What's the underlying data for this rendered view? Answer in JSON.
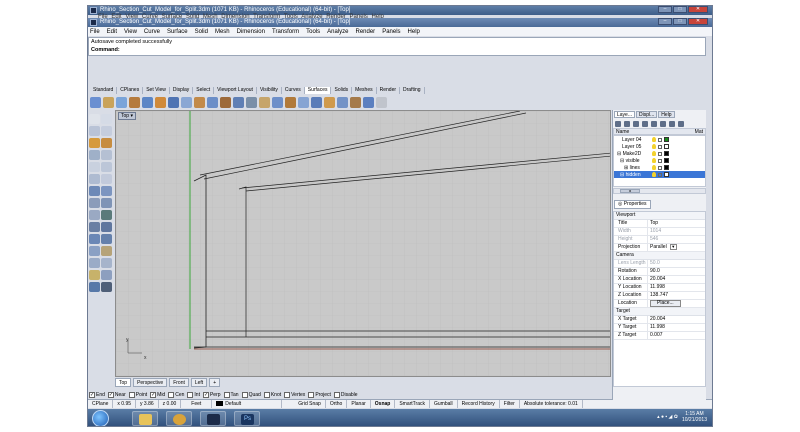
{
  "window": {
    "title_top": "Rhino_Section_Cut_Model_for_Split.3dm (1071 KB) - Rhinoceros (Educational) (64-bit) - [Top]",
    "title_second": "Rhino_Section_Cut_Model_for_Split.3dm (1071 KB) - Rhinoceros (Educational) (64-bit) - [Top]",
    "ghost_menu": "File  Edit  View  Curve  Surface  Solid  Mesh  Dimension  Transform  Tools  Analyze  Render  Panels  Help"
  },
  "menubar": [
    "File",
    "Edit",
    "View",
    "Curve",
    "Surface",
    "Solid",
    "Mesh",
    "Dimension",
    "Transform",
    "Tools",
    "Analyze",
    "Render",
    "Panels",
    "Help"
  ],
  "command": {
    "history": "Autosave completed successfully",
    "prompt": "Command:"
  },
  "toolbar_tabs": [
    "Standard",
    "CPlanes",
    "Set View",
    "Display",
    "Select",
    "Viewport Layout",
    "Visibility",
    "Curves",
    "Surfaces",
    "Solids",
    "Meshes",
    "Render",
    "Drafting"
  ],
  "toolbar_active_tab": "Surfaces",
  "viewport": {
    "name": "Top",
    "axis_x": "x",
    "axis_y": "y"
  },
  "view_tabs": [
    "Top",
    "Perspective",
    "Front",
    "Left"
  ],
  "view_tabs_add": "+",
  "osnaps": [
    {
      "label": "End",
      "checked": true
    },
    {
      "label": "Near",
      "checked": true
    },
    {
      "label": "Point",
      "checked": false
    },
    {
      "label": "Mid",
      "checked": true
    },
    {
      "label": "Cen",
      "checked": false
    },
    {
      "label": "Int",
      "checked": false
    },
    {
      "label": "Perp",
      "checked": true
    },
    {
      "label": "Tan",
      "checked": false
    },
    {
      "label": "Quad",
      "checked": false
    },
    {
      "label": "Knot",
      "checked": false
    },
    {
      "label": "Vertex",
      "checked": false
    },
    {
      "label": "Project",
      "checked": false
    },
    {
      "label": "Disable",
      "checked": false
    }
  ],
  "status": {
    "cplane": "CPlane",
    "x": "x 0.95",
    "y": "y 3.86",
    "z": "z 0.00",
    "units": "Feet",
    "layer": "Default",
    "grid_snap": "Grid Snap",
    "ortho": "Ortho",
    "planar": "Planar",
    "osnap": "Osnap",
    "smarttrack": "SmartTrack",
    "gumball": "Gumball",
    "record_history": "Record History",
    "filter": "Filter",
    "tolerance": "Absolute tolerance: 0.01"
  },
  "panel": {
    "tabs": [
      "Laye...",
      "Displ...",
      "Help"
    ],
    "layer_header_name": "Name",
    "layer_header_mat": "Mat",
    "layers": [
      {
        "name": "Layer 04",
        "color": "#1a8c1a",
        "selected": false
      },
      {
        "name": "Layer 05",
        "color": "#ffffff",
        "selected": false
      },
      {
        "name": "Make2D",
        "color": "#000000",
        "selected": false
      },
      {
        "name": "visible",
        "color": "#000000",
        "selected": false
      },
      {
        "name": "lines",
        "color": "#000000",
        "selected": false
      },
      {
        "name": "hidden",
        "color": "#ffffff",
        "selected": true
      }
    ],
    "scroll_thumb": "III",
    "properties_tab": "Properties",
    "properties": {
      "section_viewport": "Viewport",
      "title_k": "Title",
      "title_v": "Top",
      "width_k": "Width",
      "width_v": "1014",
      "height_k": "Height",
      "height_v": "546",
      "projection_k": "Projection",
      "projection_v": "Parallel",
      "section_camera": "Camera",
      "lens_k": "Lens Length",
      "lens_v": "50.0",
      "rotation_k": "Rotation",
      "rotation_v": "90.0",
      "xloc_k": "X Location",
      "xloc_v": "20.004",
      "yloc_k": "Y Location",
      "yloc_v": "11.998",
      "zloc_k": "Z Location",
      "zloc_v": "138.747",
      "location_k": "Location",
      "location_btn": "Place...",
      "section_target": "Target",
      "xt_k": "X Target",
      "xt_v": "20.004",
      "yt_k": "Y Target",
      "yt_v": "11.998",
      "zt_k": "Z Target",
      "zt_v": "0.007"
    }
  },
  "tray": {
    "time": "1:15 AM",
    "date": "10/21/2013"
  }
}
